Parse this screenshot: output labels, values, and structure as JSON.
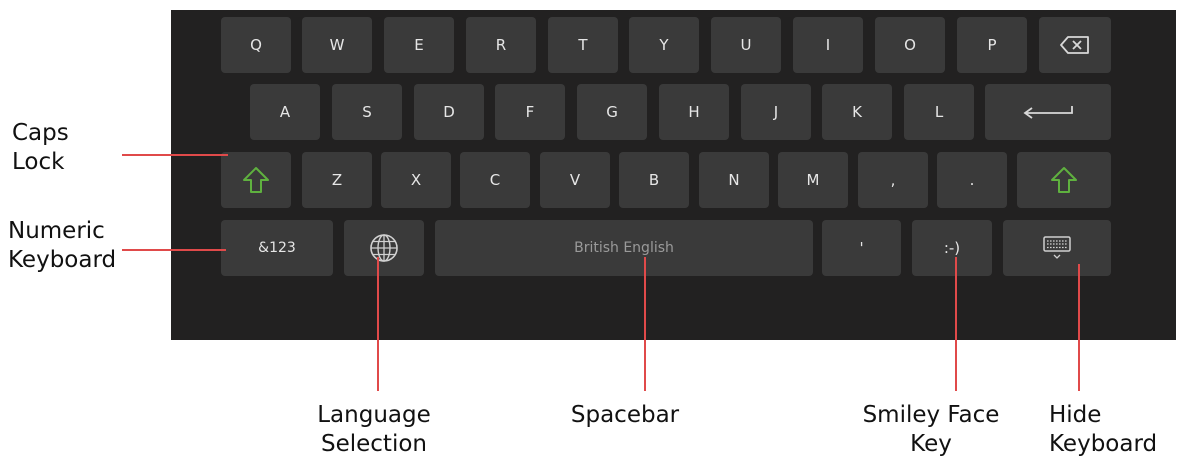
{
  "keyboard": {
    "row1": [
      "Q",
      "W",
      "E",
      "R",
      "T",
      "Y",
      "U",
      "I",
      "O",
      "P"
    ],
    "row2": [
      "A",
      "S",
      "D",
      "F",
      "G",
      "H",
      "J",
      "K",
      "L"
    ],
    "row3": [
      "Z",
      "X",
      "C",
      "V",
      "B",
      "N",
      "M",
      ",",
      "."
    ],
    "numeric_label": "&123",
    "space_label": "British English",
    "apostrophe_label": "'",
    "smiley_label": ":-)"
  },
  "colors": {
    "shift_arrow": "#5fb13f",
    "leader_line": "#e04a4a"
  },
  "icons": {
    "backspace": "backspace-icon",
    "enter": "enter-icon",
    "shift": "shift-arrow-icon",
    "language": "globe-icon",
    "hide": "keyboard-hide-icon"
  },
  "callouts": {
    "caps_lock": "Caps\nLock",
    "numeric_keyboard": "Numeric\nKeyboard",
    "language_selection": "Language\nSelection",
    "spacebar": "Spacebar",
    "smiley_face_key": "Smiley Face\nKey",
    "hide_keyboard": "Hide\nKeyboard"
  }
}
